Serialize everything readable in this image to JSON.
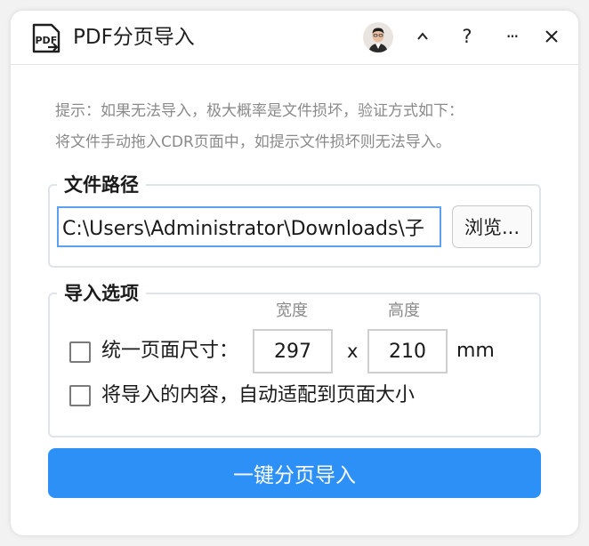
{
  "window": {
    "title": "PDF分页导入",
    "app_icon_text": "PDF"
  },
  "titlebar": {
    "collapse_label": "^",
    "help_label": "?",
    "more_label": "···",
    "close_label": "✕"
  },
  "hint": {
    "line1": "提示：如果无法导入，极大概率是文件损坏，验证方式如下：",
    "line2": "将文件手动拖入CDR页面中，如提示文件损坏则无法导入。"
  },
  "file_path": {
    "legend": "文件路径",
    "value": "C:\\Users\\Administrator\\Downloads\\子",
    "browse_label": "浏览..."
  },
  "import_options": {
    "legend": "导入选项",
    "width_label": "宽度",
    "height_label": "高度",
    "uniform_size_label": "统一页面尺寸：",
    "uniform_size_checked": false,
    "width_value": "297",
    "times_symbol": "x",
    "height_value": "210",
    "unit": "mm",
    "fit_page_label": "将导入的内容，自动适配到页面大小",
    "fit_page_checked": false
  },
  "action": {
    "import_label": "一键分页导入"
  },
  "colors": {
    "primary": "#2d90f7",
    "input_focus_border": "#5aa2f0",
    "hint_text": "#8a8a8a"
  },
  "icons": [
    "pdf-app-icon",
    "user-avatar",
    "collapse-icon",
    "help-icon",
    "more-icon",
    "close-icon"
  ]
}
